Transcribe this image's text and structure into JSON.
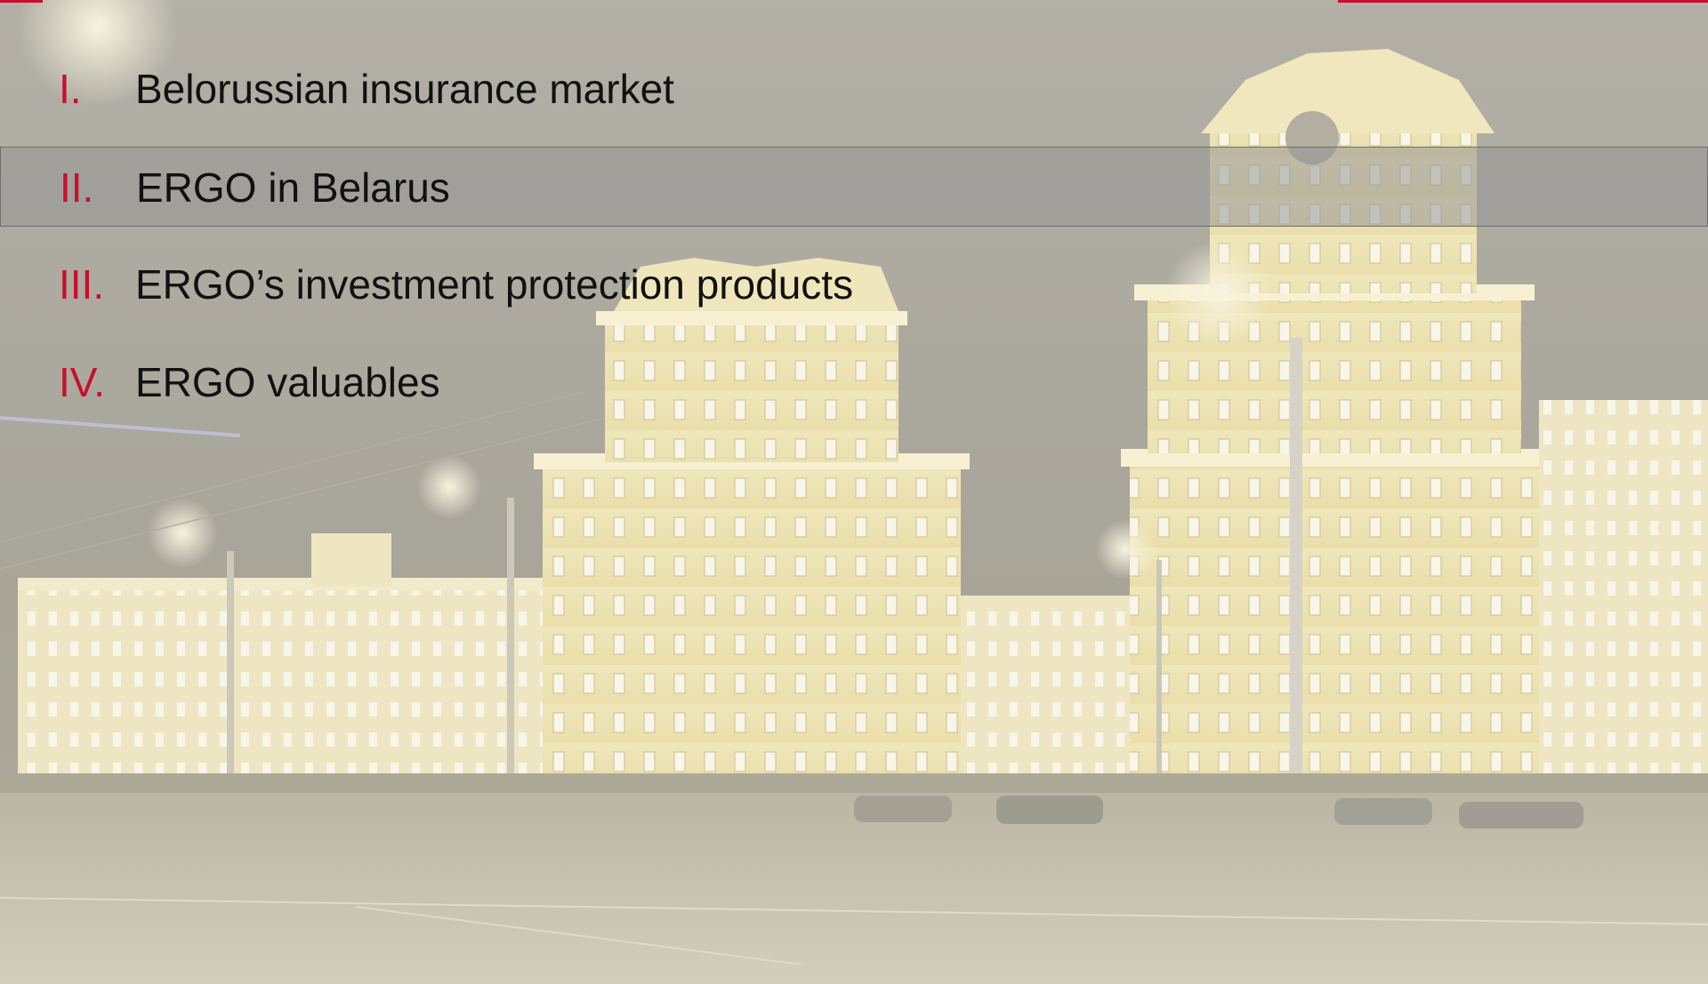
{
  "colors": {
    "accent": "#c8102e",
    "text": "#111111",
    "highlight_row": "#969696"
  },
  "agenda": {
    "active_index": 1,
    "items": [
      {
        "numeral": "I.",
        "label": "Belorussian insurance market"
      },
      {
        "numeral": "II.",
        "label": "ERGO in Belarus"
      },
      {
        "numeral": "III.",
        "label": "ERGO’s investment protection products"
      },
      {
        "numeral": "IV.",
        "label": "ERGO valuables"
      }
    ]
  }
}
